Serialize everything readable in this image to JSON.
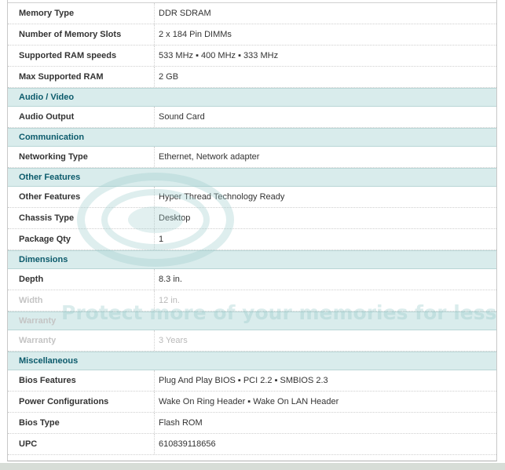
{
  "spec_table": {
    "rows": [
      {
        "kind": "attr",
        "label": "Memory Type",
        "value": "DDR SDRAM"
      },
      {
        "kind": "attr",
        "label": "Number of Memory Slots",
        "value": "2 x 184 Pin DIMMs"
      },
      {
        "kind": "attr",
        "label": "Supported RAM speeds",
        "value": "533 MHz ▪ 400 MHz ▪ 333 MHz"
      },
      {
        "kind": "attr",
        "label": "Max Supported RAM",
        "value": "2 GB"
      },
      {
        "kind": "section",
        "label": "Audio / Video"
      },
      {
        "kind": "attr",
        "label": "Audio Output",
        "value": "Sound Card"
      },
      {
        "kind": "section",
        "label": "Communication"
      },
      {
        "kind": "attr",
        "label": "Networking Type",
        "value": "Ethernet, Network adapter"
      },
      {
        "kind": "section",
        "label": "Other Features"
      },
      {
        "kind": "attr",
        "label": "Other Features",
        "value": "Hyper Thread Technology Ready"
      },
      {
        "kind": "attr",
        "label": "Chassis Type",
        "value": "Desktop"
      },
      {
        "kind": "attr",
        "label": "Package Qty",
        "value": "1"
      },
      {
        "kind": "section",
        "label": "Dimensions"
      },
      {
        "kind": "attr",
        "label": "Depth",
        "value": "8.3 in."
      },
      {
        "kind": "attr",
        "label": "Width",
        "value": "12 in.",
        "faded": true
      },
      {
        "kind": "section",
        "label": "Warranty",
        "faded": true
      },
      {
        "kind": "attr",
        "label": "Warranty",
        "value": "3 Years",
        "faded": true
      },
      {
        "kind": "section",
        "label": "Miscellaneous"
      },
      {
        "kind": "attr",
        "label": "Bios Features",
        "value": "Plug And Play BIOS ▪ PCI 2.2 ▪ SMBIOS 2.3"
      },
      {
        "kind": "attr",
        "label": "Power Configurations",
        "value": "Wake On Ring Header ▪ Wake On LAN Header"
      },
      {
        "kind": "attr",
        "label": "Bios Type",
        "value": "Flash ROM"
      },
      {
        "kind": "attr",
        "label": "UPC",
        "value": "610839118656"
      }
    ]
  },
  "watermark": {
    "text": "Protect more of your memories for less!"
  },
  "colors": {
    "section_bg": "#d9ecec",
    "section_text": "#0b5a6b",
    "watermark": "#96c8c8"
  }
}
